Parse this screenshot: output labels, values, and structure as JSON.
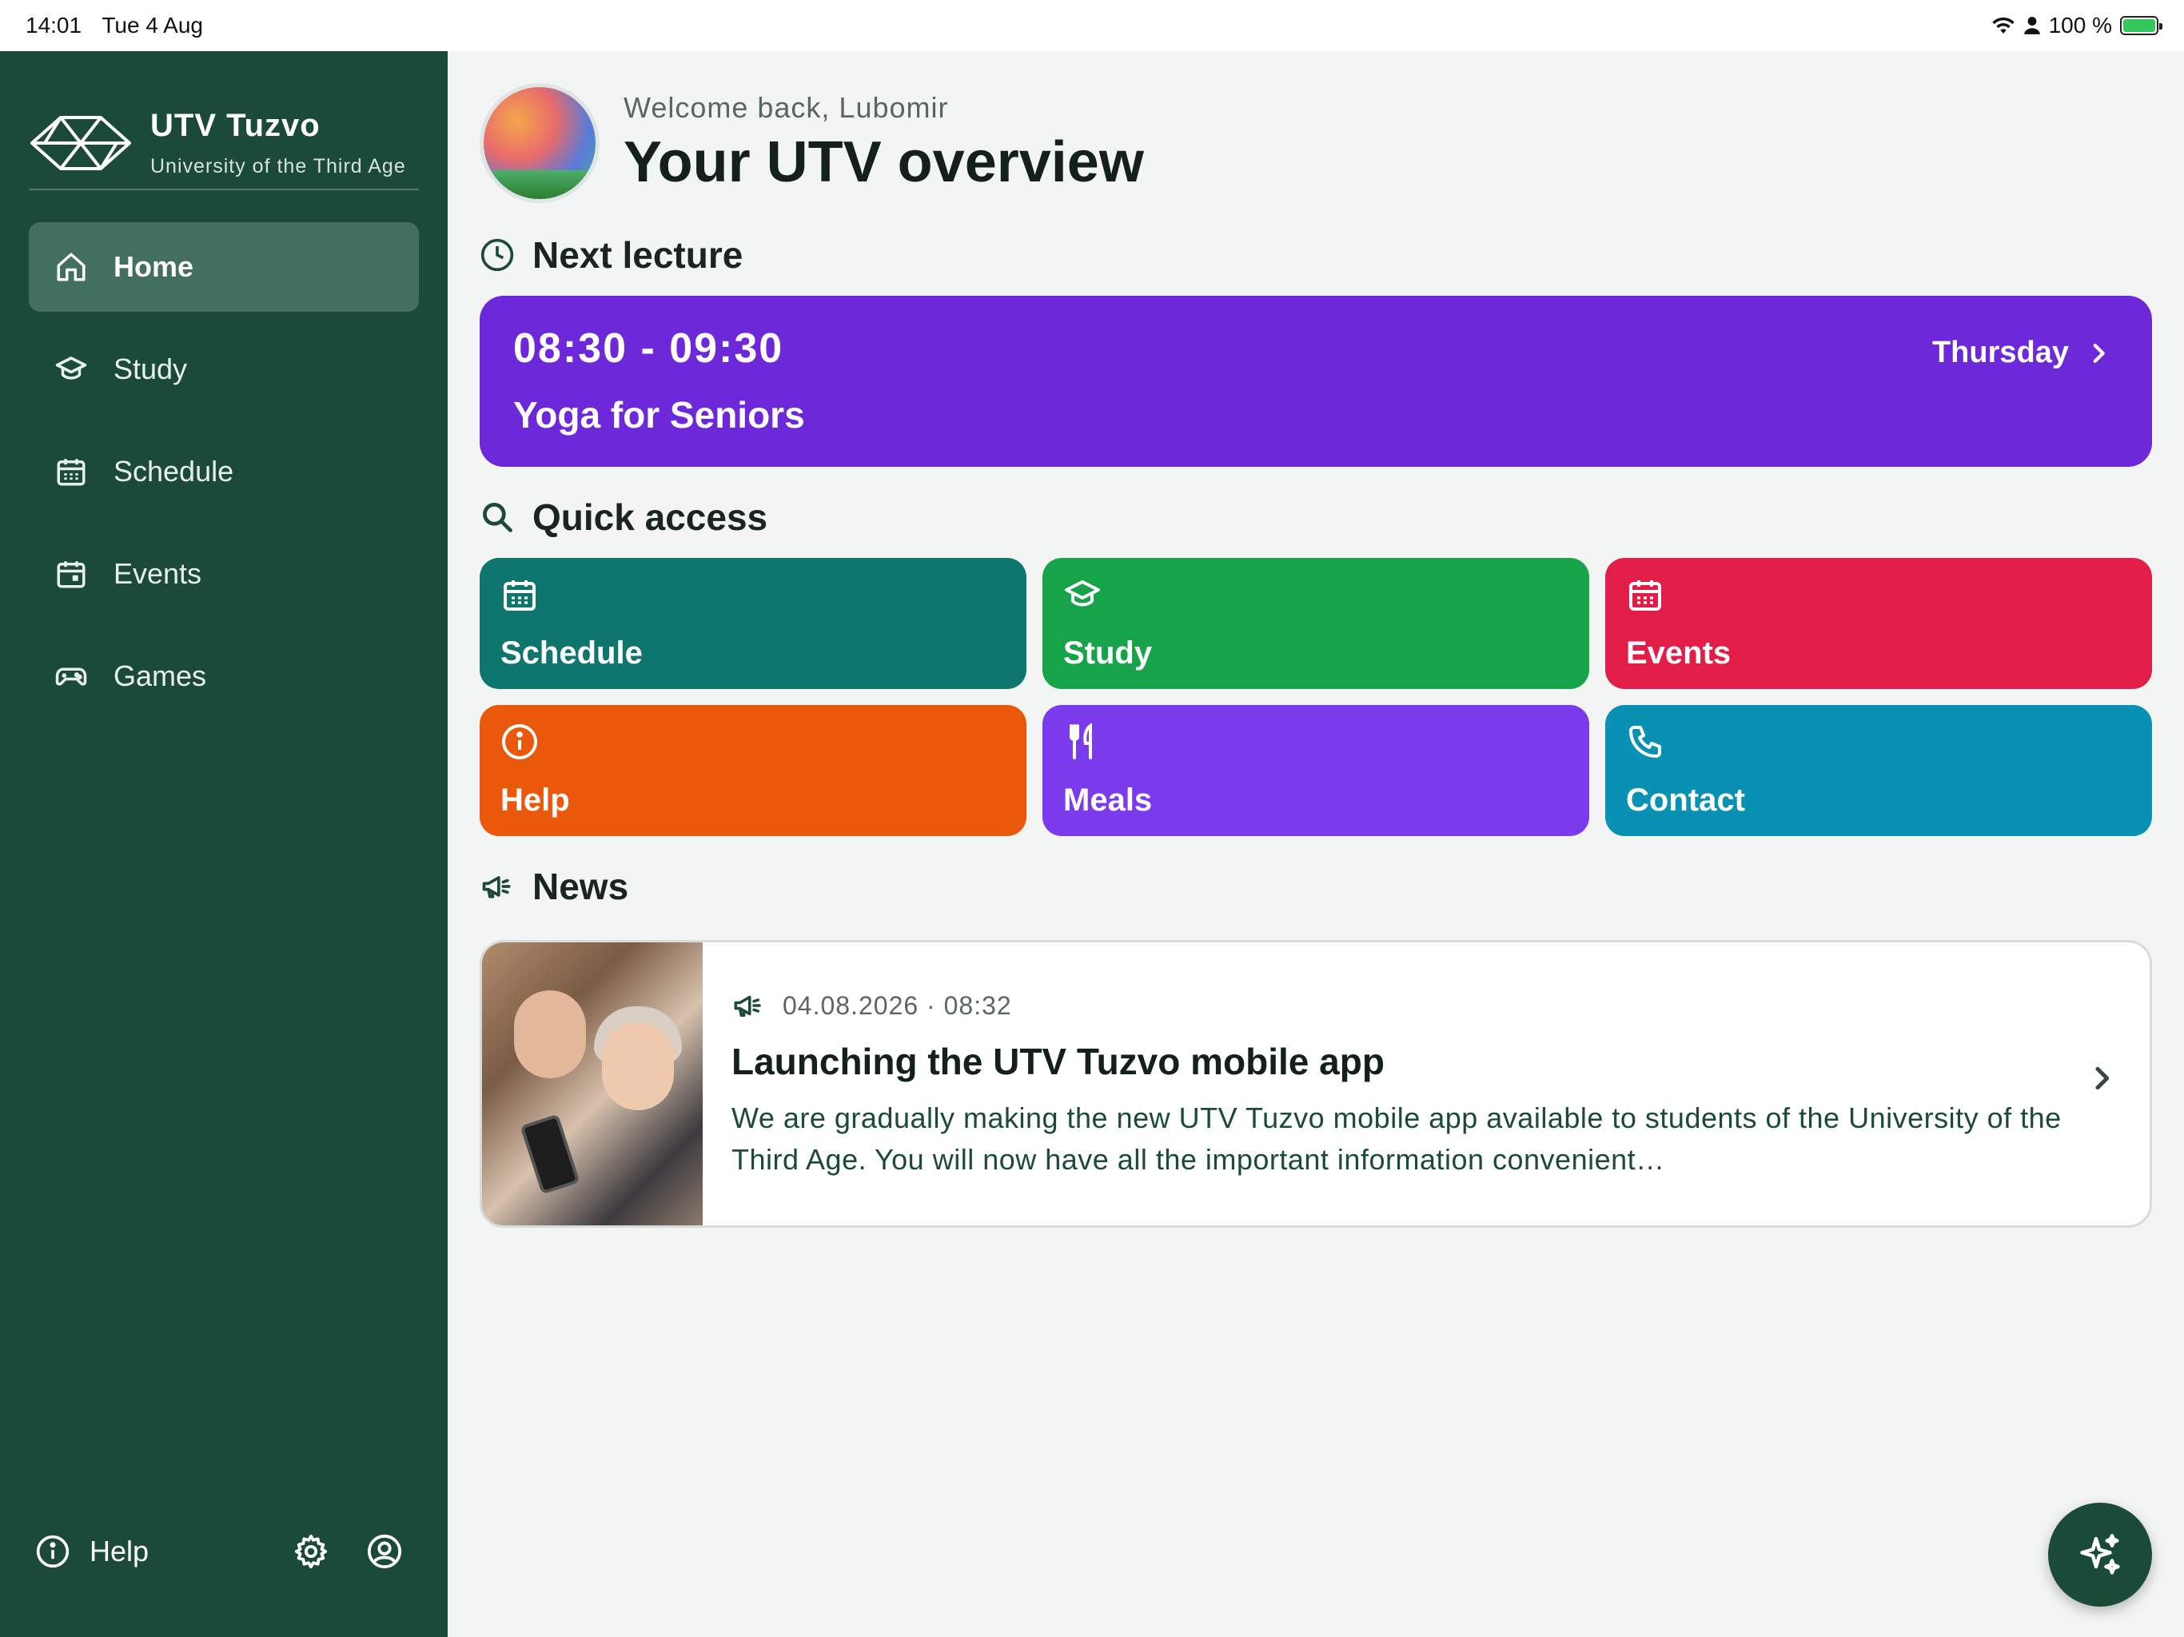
{
  "status_bar": {
    "time": "14:01",
    "date": "Tue 4 Aug",
    "battery": "100 %"
  },
  "sidebar": {
    "brand_title": "UTV Tuzvo",
    "brand_subtitle": "University of the Third Age",
    "items": [
      {
        "label": "Home",
        "icon": "home-icon",
        "active": true
      },
      {
        "label": "Study",
        "icon": "graduation-cap-icon",
        "active": false
      },
      {
        "label": "Schedule",
        "icon": "calendar-icon",
        "active": false
      },
      {
        "label": "Events",
        "icon": "calendar-event-icon",
        "active": false
      },
      {
        "label": "Games",
        "icon": "gamepad-icon",
        "active": false
      }
    ],
    "help_label": "Help"
  },
  "header": {
    "welcome": "Welcome back, Lubomir",
    "title": "Your UTV overview"
  },
  "next_lecture": {
    "section_title": "Next lecture",
    "time": "08:30 - 09:30",
    "title": "Yoga for Seniors",
    "day": "Thursday",
    "color": "#6d28d9"
  },
  "quick_access": {
    "section_title": "Quick access",
    "tiles": [
      {
        "label": "Schedule",
        "icon": "calendar-icon",
        "color": "#0f766e"
      },
      {
        "label": "Study",
        "icon": "graduation-cap-icon",
        "color": "#16a34a"
      },
      {
        "label": "Events",
        "icon": "calendar-event-icon",
        "color": "#e11d48"
      },
      {
        "label": "Help",
        "icon": "info-icon",
        "color": "#ea580c"
      },
      {
        "label": "Meals",
        "icon": "fork-knife-icon",
        "color": "#7c3aed"
      },
      {
        "label": "Contact",
        "icon": "phone-icon",
        "color": "#0891b2"
      }
    ]
  },
  "news": {
    "section_title": "News",
    "items": [
      {
        "meta": "04.08.2026 · 08:32",
        "title": "Launching the UTV Tuzvo mobile app",
        "text": "We are gradually making the new UTV Tuzvo mobile app available to students of the University of the Third Age. You will now have all the important information convenient…"
      }
    ]
  },
  "colors": {
    "sidebar_bg": "#1b4b36",
    "page_bg": "#f3f5f4"
  }
}
